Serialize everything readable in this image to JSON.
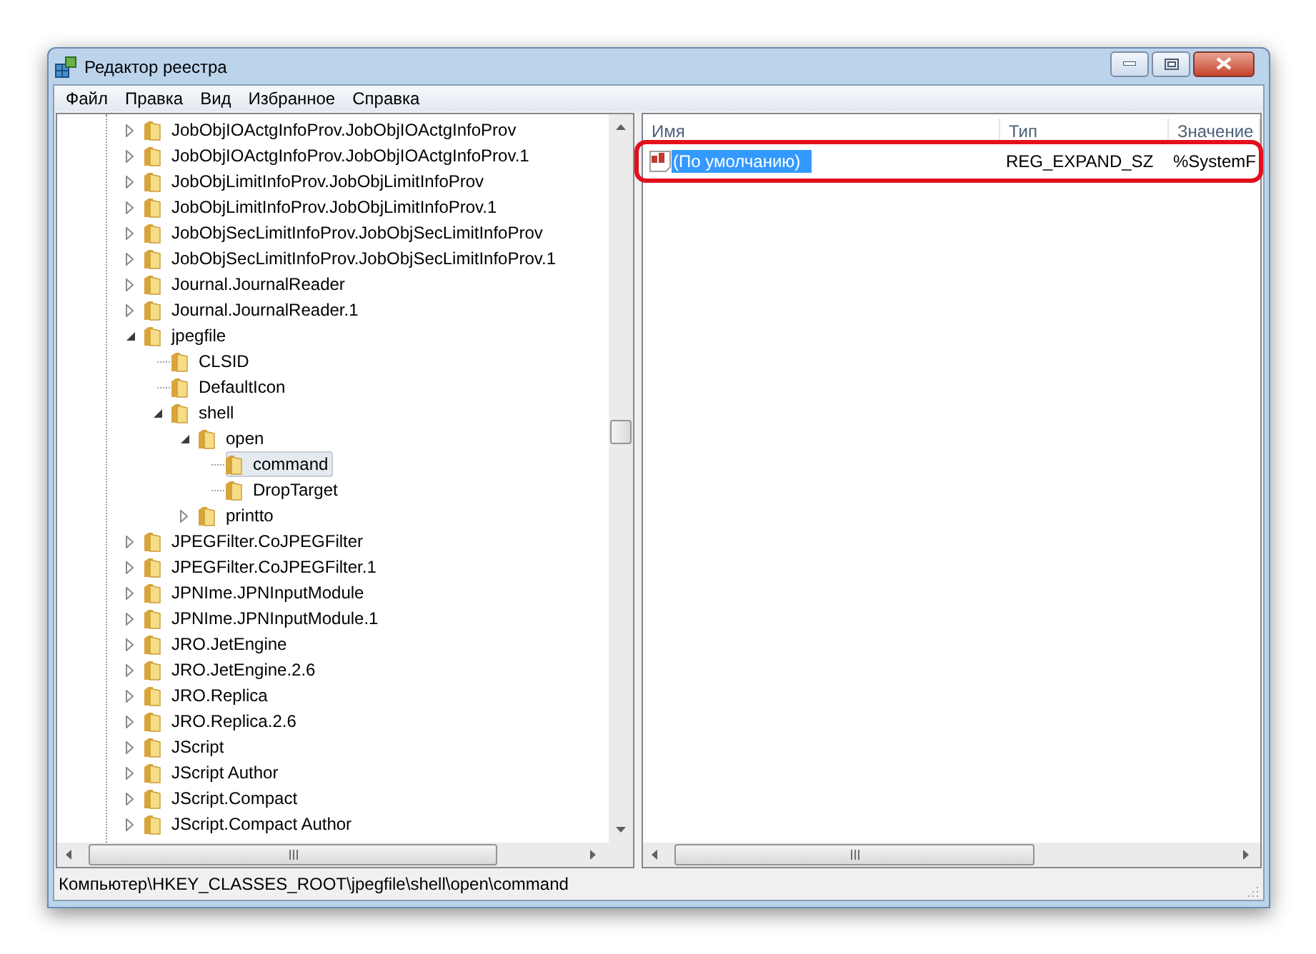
{
  "window": {
    "title": "Редактор реестра"
  },
  "menu": [
    "Файл",
    "Правка",
    "Вид",
    "Избранное",
    "Справка"
  ],
  "tree": [
    {
      "label": "JobObjIOActgInfoProv.JobObjIOActgInfoProv",
      "kind": "node",
      "expanded": false,
      "selected": false
    },
    {
      "label": "JobObjIOActgInfoProv.JobObjIOActgInfoProv.1",
      "kind": "node",
      "expanded": false,
      "selected": false
    },
    {
      "label": "JobObjLimitInfoProv.JobObjLimitInfoProv",
      "kind": "node",
      "expanded": false,
      "selected": false
    },
    {
      "label": "JobObjLimitInfoProv.JobObjLimitInfoProv.1",
      "kind": "node",
      "expanded": false,
      "selected": false
    },
    {
      "label": "JobObjSecLimitInfoProv.JobObjSecLimitInfoProv",
      "kind": "node",
      "expanded": false,
      "selected": false
    },
    {
      "label": "JobObjSecLimitInfoProv.JobObjSecLimitInfoProv.1",
      "kind": "node",
      "expanded": false,
      "selected": false
    },
    {
      "label": "Journal.JournalReader",
      "kind": "node",
      "expanded": false,
      "selected": false
    },
    {
      "label": "Journal.JournalReader.1",
      "kind": "node",
      "expanded": false,
      "selected": false
    },
    {
      "label": "jpegfile",
      "kind": "node",
      "expanded": true,
      "selected": false,
      "children": [
        {
          "label": "CLSID",
          "kind": "leaf",
          "selected": false
        },
        {
          "label": "DefaultIcon",
          "kind": "leaf",
          "selected": false
        },
        {
          "label": "shell",
          "kind": "node",
          "expanded": true,
          "selected": false,
          "children": [
            {
              "label": "open",
              "kind": "node",
              "expanded": true,
              "selected": false,
              "children": [
                {
                  "label": "command",
                  "kind": "leaf",
                  "selected": true
                },
                {
                  "label": "DropTarget",
                  "kind": "leaf",
                  "selected": false
                }
              ]
            },
            {
              "label": "printto",
              "kind": "node",
              "expanded": false,
              "selected": false
            }
          ]
        }
      ]
    },
    {
      "label": "JPEGFilter.CoJPEGFilter",
      "kind": "node",
      "expanded": false,
      "selected": false
    },
    {
      "label": "JPEGFilter.CoJPEGFilter.1",
      "kind": "node",
      "expanded": false,
      "selected": false
    },
    {
      "label": "JPNIme.JPNInputModule",
      "kind": "node",
      "expanded": false,
      "selected": false
    },
    {
      "label": "JPNIme.JPNInputModule.1",
      "kind": "node",
      "expanded": false,
      "selected": false
    },
    {
      "label": "JRO.JetEngine",
      "kind": "node",
      "expanded": false,
      "selected": false
    },
    {
      "label": "JRO.JetEngine.2.6",
      "kind": "node",
      "expanded": false,
      "selected": false
    },
    {
      "label": "JRO.Replica",
      "kind": "node",
      "expanded": false,
      "selected": false
    },
    {
      "label": "JRO.Replica.2.6",
      "kind": "node",
      "expanded": false,
      "selected": false
    },
    {
      "label": "JScript",
      "kind": "node",
      "expanded": false,
      "selected": false
    },
    {
      "label": "JScript Author",
      "kind": "node",
      "expanded": false,
      "selected": false
    },
    {
      "label": "JScript.Compact",
      "kind": "node",
      "expanded": false,
      "selected": false
    },
    {
      "label": "JScript.Compact Author",
      "kind": "node",
      "expanded": false,
      "selected": false
    }
  ],
  "values": {
    "columns": [
      "Имя",
      "Тип",
      "Значение"
    ],
    "rows": [
      {
        "name": "(По умолчанию)",
        "type": "REG_EXPAND_SZ",
        "value": "%SystemF",
        "selected": true,
        "highlighted": true
      }
    ]
  },
  "status_bar": "Компьютер\\HKEY_CLASSES_ROOT\\jpegfile\\shell\\open\\command"
}
